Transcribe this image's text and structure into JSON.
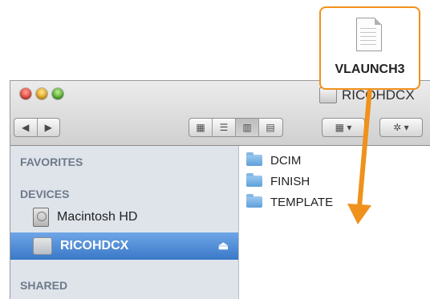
{
  "window": {
    "title": "RICOHDCX"
  },
  "toolbar": {
    "back_icon": "back-arrow-icon",
    "forward_icon": "forward-arrow-icon",
    "views": [
      "icon-view-icon",
      "list-view-icon",
      "column-view-icon",
      "cover-flow-icon"
    ],
    "active_view": "column-view-icon",
    "arrange_icon": "arrange-icon",
    "action_icon": "gear-icon"
  },
  "sidebar": {
    "favorites_header": "FAVORITES",
    "devices_header": "DEVICES",
    "shared_header": "SHARED",
    "devices": [
      {
        "label": "Macintosh HD",
        "icon": "hard-disk-icon",
        "selected": false
      },
      {
        "label": "RICOHDCX",
        "icon": "usb-drive-icon",
        "selected": true
      }
    ]
  },
  "folders": [
    {
      "label": "DCIM"
    },
    {
      "label": "FINISH"
    },
    {
      "label": "TEMPLATE"
    }
  ],
  "callout": {
    "file_label": "VLAUNCH3",
    "icon": "document-icon",
    "accent": "#f0911c"
  },
  "colors": {
    "sidebar_bg": "#dfe4eb",
    "selection": "#3a78c7",
    "header": "#6e7a89"
  }
}
